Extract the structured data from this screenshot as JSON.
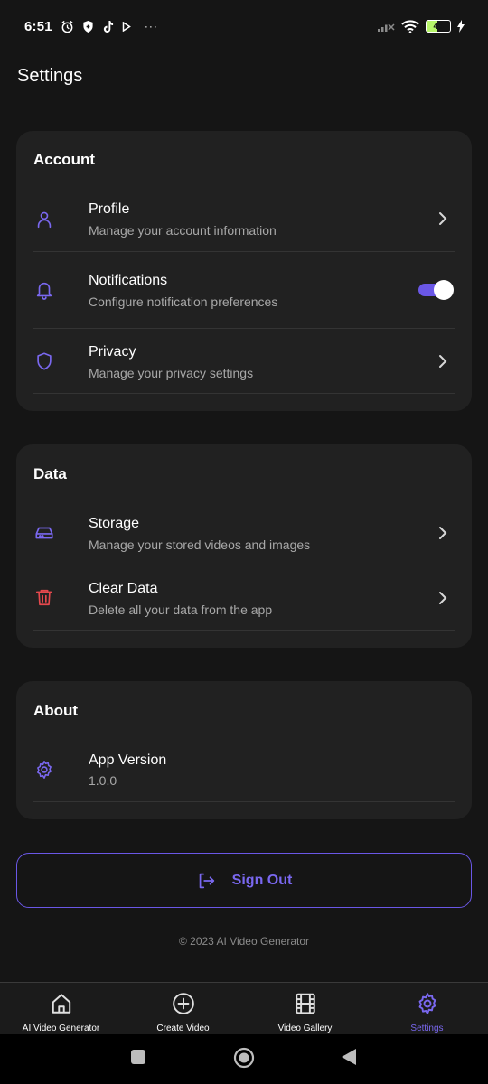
{
  "status_bar": {
    "time": "6:51",
    "battery": "46",
    "icons": [
      "alarm-icon",
      "vpn-shield-icon",
      "tiktok-icon",
      "play-icon",
      "more-dots-icon",
      "signal-icon",
      "wifi-icon",
      "battery-icon",
      "charging-bolt-icon"
    ],
    "more": "···"
  },
  "header": {
    "title": "Settings"
  },
  "sections": {
    "account": {
      "title": "Account",
      "items": [
        {
          "title": "Profile",
          "subtitle": "Manage your account information",
          "icon": "user-icon",
          "control": "chevron"
        },
        {
          "title": "Notifications",
          "subtitle": "Configure notification preferences",
          "icon": "bell-icon",
          "control": "toggle",
          "toggle_on": true
        },
        {
          "title": "Privacy",
          "subtitle": "Manage your privacy settings",
          "icon": "shield-icon",
          "control": "chevron"
        }
      ]
    },
    "data": {
      "title": "Data",
      "items": [
        {
          "title": "Storage",
          "subtitle": "Manage your stored videos and images",
          "icon": "hard-drive-icon",
          "control": "chevron"
        },
        {
          "title": "Clear Data",
          "subtitle": "Delete all your data from the app",
          "icon": "trash-icon",
          "control": "chevron"
        }
      ]
    },
    "about": {
      "title": "About",
      "items": [
        {
          "title": "App Version",
          "subtitle": "1.0.0",
          "icon": "gear-icon"
        }
      ]
    }
  },
  "sign_out": {
    "label": "Sign Out",
    "icon": "logout-icon"
  },
  "footer": {
    "copyright": "© 2023 AI Video Generator"
  },
  "bottom_nav": {
    "active": "Settings",
    "items": [
      {
        "label": "AI Video Generator",
        "icon": "home-icon"
      },
      {
        "label": "Create Video",
        "icon": "plus-circle-icon"
      },
      {
        "label": "Video Gallery",
        "icon": "film-icon"
      },
      {
        "label": "Settings",
        "icon": "gear-icon"
      }
    ]
  },
  "colors": {
    "background": "#151515",
    "card": "#212121",
    "accent": "#6a57e6",
    "accent_text": "#7a68f0",
    "danger": "#e5484d",
    "subtitle": "#a8a8a8",
    "divider": "#343434"
  }
}
